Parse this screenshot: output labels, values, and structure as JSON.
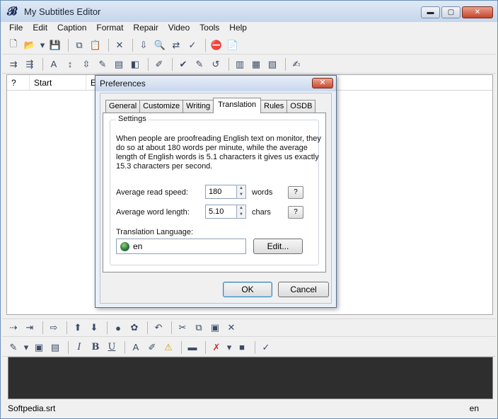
{
  "window": {
    "title": "My Subtitles Editor",
    "min_symbol": "▬",
    "max_symbol": "▢",
    "close_symbol": "✕"
  },
  "menu": [
    "File",
    "Edit",
    "Caption",
    "Format",
    "Repair",
    "Video",
    "Tools",
    "Help"
  ],
  "toolbar1_icons": [
    "new-icon",
    "open-icon",
    "dropdown-icon",
    "save-icon",
    "copy-icon",
    "paste-icon",
    "delete-icon",
    "import-icon",
    "find-icon",
    "replace-icon",
    "spellcheck-icon",
    "stop-icon",
    "notes-icon"
  ],
  "toolbar1_glyphs": [
    "🗋",
    "📂",
    "▾",
    "💾",
    "⧉",
    "📋",
    "✕",
    "⇩",
    "🔍",
    "⇄",
    "✓",
    "⛔",
    "📄"
  ],
  "toolbar2_glyphs": [
    "⇉",
    "⇶",
    "A",
    "↕",
    "⇳",
    "✎",
    "▤",
    "◧",
    "✐",
    "✔",
    "✎",
    "↺",
    "▥",
    "▦",
    "▧",
    "✍"
  ],
  "grid": {
    "columns": [
      "?",
      "Start",
      "E"
    ]
  },
  "toolbar3_glyphs": [
    "⇢",
    "⇥",
    "⇨",
    "⬆",
    "⬇",
    "●",
    "✿",
    "↶",
    "✂",
    "⧉",
    "▣",
    "✕"
  ],
  "toolbar4_glyphs": [
    "✎",
    "▾",
    "▣",
    "▤",
    "I",
    "B",
    "U",
    "A",
    "✐",
    "⚠",
    "▬",
    "✗",
    "▾",
    "■",
    "✓"
  ],
  "status": {
    "file": "Softpedia.srt",
    "lang": "en"
  },
  "dialog": {
    "title": "Preferences",
    "close_symbol": "✕",
    "tabs": [
      "General",
      "Customize",
      "Writing",
      "Translation",
      "Rules",
      "OSDB"
    ],
    "active_tab": "Translation",
    "group_title": "Settings",
    "description": "When people are proofreading English text on monitor, they do so at about 180 words per minute, while the average length of English words is 5.1 characters it gives us exactly 15.3 characters per second.",
    "read_speed": {
      "label": "Average read speed:",
      "value": "180",
      "unit": "words",
      "help": "?"
    },
    "word_length": {
      "label": "Average word length:",
      "value": "5.10",
      "unit": "chars",
      "help": "?"
    },
    "lang": {
      "label": "Translation Language:",
      "value": "en",
      "edit_label": "Edit..."
    },
    "ok_label": "OK",
    "cancel_label": "Cancel",
    "spin_up": "▲",
    "spin_down": "▼"
  }
}
